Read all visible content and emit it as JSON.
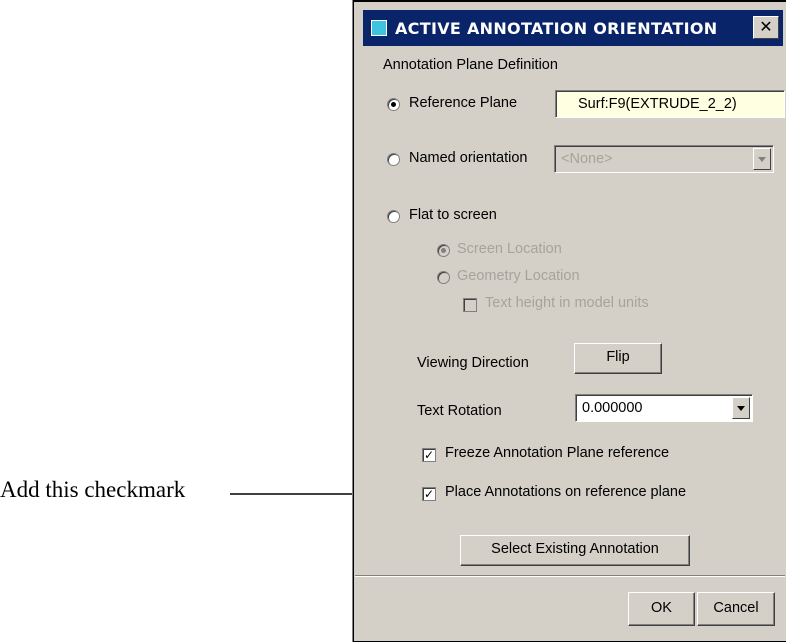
{
  "dialog": {
    "title": "ACTIVE ANNOTATION ORIENTATION",
    "close_label": "✕",
    "section_label": "Annotation Plane Definition",
    "reference_plane": {
      "label": "Reference Plane",
      "value": "Surf:F9(EXTRUDE_2_2)",
      "selected": true
    },
    "named_orientation": {
      "label": "Named orientation",
      "value": "<None>",
      "selected": false
    },
    "flat_to_screen": {
      "label": "Flat to screen",
      "selected": false,
      "screen_location": "Screen Location",
      "geometry_location": "Geometry Location",
      "text_height": "Text height in model units"
    },
    "viewing_direction": {
      "label": "Viewing Direction",
      "button": "Flip"
    },
    "text_rotation": {
      "label": "Text Rotation",
      "value": "0.000000"
    },
    "freeze_ref": {
      "label": "Freeze Annotation Plane reference",
      "checked": true
    },
    "place_on_ref": {
      "label": "Place Annotations on reference plane",
      "checked": true
    },
    "select_existing": "Select Existing Annotation",
    "ok": "OK",
    "cancel": "Cancel"
  },
  "callout": {
    "text": "Add this checkmark"
  }
}
